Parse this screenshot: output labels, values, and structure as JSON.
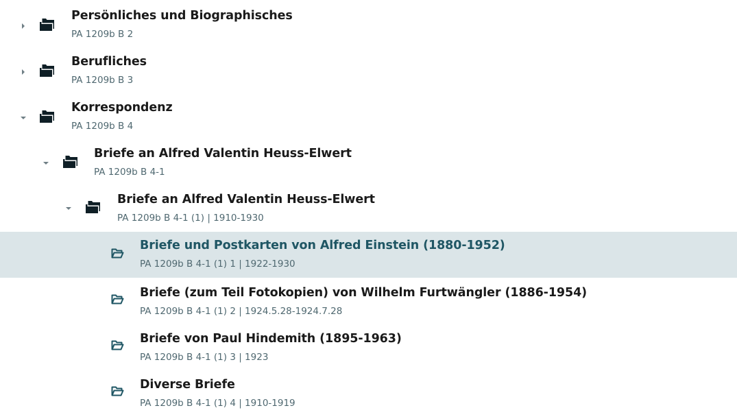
{
  "tree": {
    "selected_color": "#1f5664",
    "selected_bg": "#dbe5e8",
    "folder_color": "#0f1f26",
    "nodes": [
      {
        "title": "Persönliches und Biographisches",
        "signature": "PA 1209b B 2",
        "state": "collapsed",
        "icon": "folder-filled-icon"
      },
      {
        "title": "Berufliches",
        "signature": "PA 1209b B 3",
        "state": "collapsed",
        "icon": "folder-filled-icon"
      },
      {
        "title": "Korrespondenz",
        "signature": "PA 1209b B 4",
        "state": "expanded",
        "icon": "folder-filled-icon"
      },
      {
        "title": "Briefe an Alfred Valentin Heuss-Elwert",
        "signature": "PA 1209b B 4-1",
        "state": "expanded",
        "icon": "folder-filled-icon"
      },
      {
        "title": "Briefe an Alfred Valentin Heuss-Elwert",
        "signature": "PA 1209b B 4-1 (1) | 1910-1930",
        "state": "expanded",
        "icon": "folder-filled-icon"
      },
      {
        "title": "Briefe und Postkarten von Alfred Einstein (1880-1952)",
        "signature": "PA 1209b B 4-1 (1) 1 | 1922-1930",
        "state": "leaf",
        "selected": true,
        "icon": "folder-open-icon"
      },
      {
        "title": "Briefe (zum Teil Fotokopien) von Wilhelm Furtwängler (1886-1954)",
        "signature": "PA 1209b B 4-1 (1) 2 | 1924.5.28-1924.7.28",
        "state": "leaf",
        "icon": "folder-open-icon"
      },
      {
        "title": "Briefe von Paul Hindemith (1895-1963)",
        "signature": "PA 1209b B 4-1 (1) 3 | 1923",
        "state": "leaf",
        "icon": "folder-open-icon"
      },
      {
        "title": "Diverse Briefe",
        "signature": "PA 1209b B 4-1 (1) 4 | 1910-1919",
        "state": "leaf",
        "icon": "folder-open-icon"
      }
    ]
  }
}
